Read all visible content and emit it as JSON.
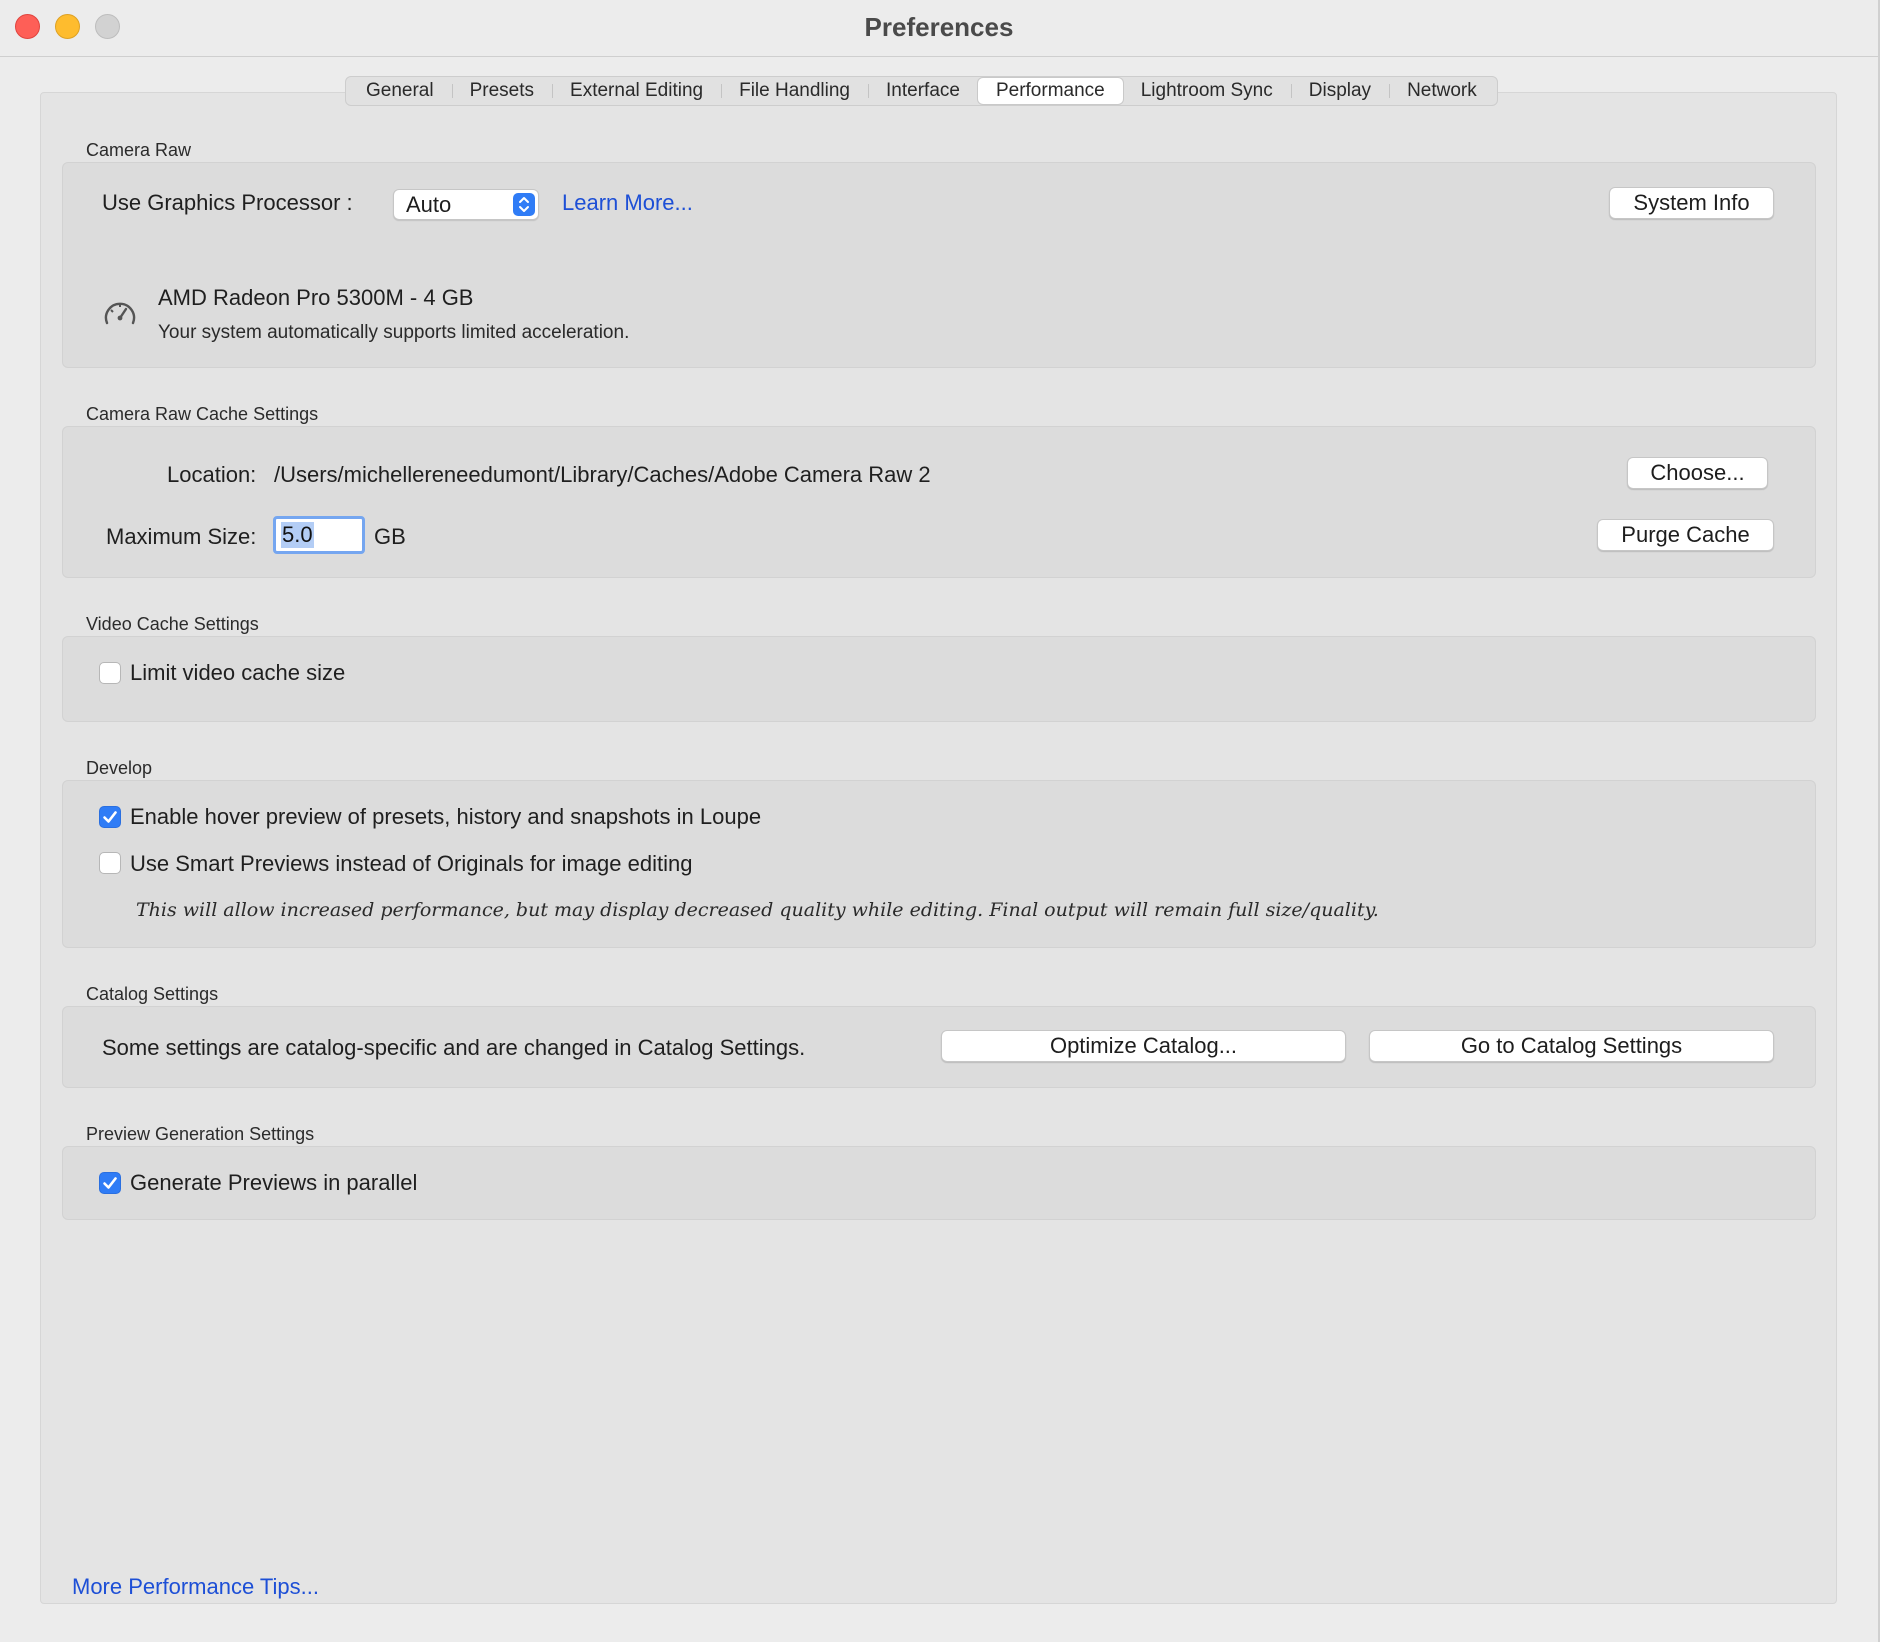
{
  "window": {
    "title": "Preferences"
  },
  "tabs": [
    {
      "label": "General"
    },
    {
      "label": "Presets"
    },
    {
      "label": "External Editing"
    },
    {
      "label": "File Handling"
    },
    {
      "label": "Interface"
    },
    {
      "label": "Performance",
      "active": true
    },
    {
      "label": "Lightroom Sync"
    },
    {
      "label": "Display"
    },
    {
      "label": "Network"
    }
  ],
  "camera_raw": {
    "section_title": "Camera Raw",
    "gpu_label": "Use Graphics Processor :",
    "gpu_value": "Auto",
    "learn_more": "Learn More...",
    "system_info": "System Info",
    "gpu_name": "AMD Radeon Pro 5300M - 4 GB",
    "gpu_status": "Your system automatically supports limited acceleration."
  },
  "cache": {
    "section_title": "Camera Raw Cache Settings",
    "location_label": "Location:",
    "location_path": "/Users/michellereneedumont/Library/Caches/Adobe Camera Raw 2",
    "choose": "Choose...",
    "max_size_label": "Maximum Size:",
    "max_size_value": "5.0",
    "max_size_unit": "GB",
    "purge": "Purge Cache"
  },
  "video_cache": {
    "section_title": "Video Cache Settings",
    "limit_label": "Limit video cache size",
    "limit_checked": false
  },
  "develop": {
    "section_title": "Develop",
    "hover_label": "Enable hover preview of presets, history and snapshots in Loupe",
    "hover_checked": true,
    "smart_label": "Use Smart Previews instead of Originals for image editing",
    "smart_checked": false,
    "smart_hint": "This will allow increased performance, but may display decreased quality while editing. Final output will remain full size/quality."
  },
  "catalog": {
    "section_title": "Catalog Settings",
    "note": "Some settings are catalog-specific and are changed in Catalog Settings.",
    "optimize": "Optimize Catalog...",
    "goto": "Go to Catalog Settings"
  },
  "preview": {
    "section_title": "Preview Generation Settings",
    "parallel_label": "Generate Previews in parallel",
    "parallel_checked": true
  },
  "footer": {
    "tips_link": "More Performance Tips..."
  },
  "colors": {
    "accent": "#2f7cf6",
    "link": "#1d4fd6"
  },
  "icons": [
    "close-icon",
    "minimize-icon",
    "zoom-icon",
    "gauge-icon",
    "chevron-updown-icon",
    "checkmark-icon"
  ]
}
